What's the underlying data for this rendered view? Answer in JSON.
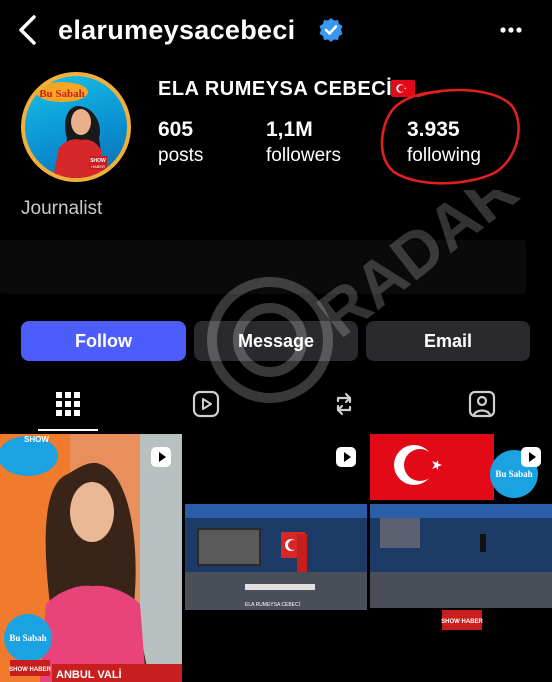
{
  "header": {
    "username": "elarumeysacebeci",
    "back_icon": "chevron-left-icon",
    "verified_icon": "verified-badge-icon",
    "more_icon": "more-horizontal-icon",
    "verified_color": "#3897f0"
  },
  "profile": {
    "display_name": "ELA RUMEYSA CEBECİ",
    "flag_icon": "turkey-flag-icon",
    "avatar_text": {
      "show": "Bu Sabah",
      "brand": "SHOW",
      "sub": "HABER"
    },
    "stats": [
      {
        "value": "605",
        "label": "posts"
      },
      {
        "value": "1,1M",
        "label": "followers"
      },
      {
        "value": "3.935",
        "label": "following"
      }
    ],
    "bio": "Journalist"
  },
  "actions": {
    "follow_label": "Follow",
    "message_label": "Message",
    "email_label": "Email",
    "follow_color": "#4d5dfb"
  },
  "tabs": [
    {
      "name": "grid",
      "icon": "grid-icon",
      "active": true
    },
    {
      "name": "reels",
      "icon": "reels-icon",
      "active": false
    },
    {
      "name": "reposts",
      "icon": "repost-icon",
      "active": false
    },
    {
      "name": "tagged",
      "icon": "tagged-icon",
      "active": false
    }
  ],
  "posts": [
    {
      "type": "reel",
      "overlay_top": "SHOW",
      "overlay_brand": "Bu Sabah",
      "overlay_bottom": "SHOW HABER",
      "ticker": "ANBUL VALİ"
    },
    {
      "type": "reel",
      "caption": "ELA RUMEYSA CEBECİ"
    },
    {
      "type": "reel",
      "overlay_brand": "Bu Sabah",
      "badge": "SHOW HABER"
    }
  ],
  "watermark": "RADAR"
}
